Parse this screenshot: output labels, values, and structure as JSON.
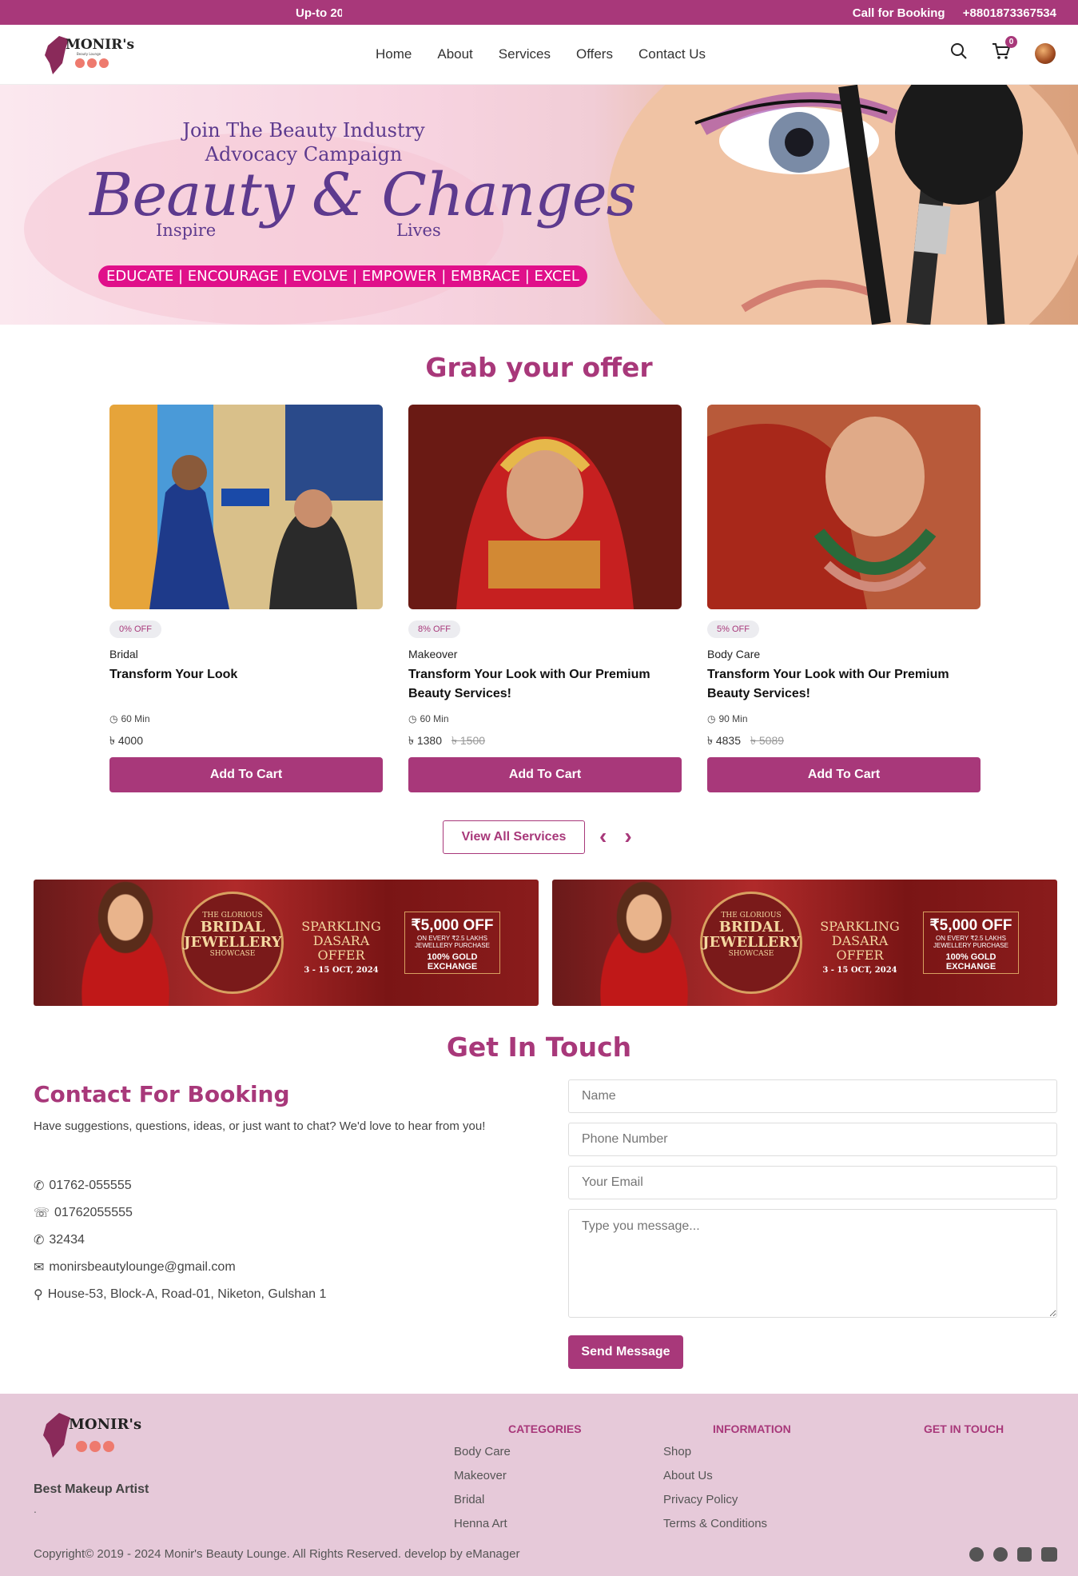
{
  "topbar": {
    "promo": "Up-to 20",
    "call_label": "Call for Booking",
    "phone": "+8801873367534"
  },
  "nav": {
    "items": [
      "Home",
      "About",
      "Services",
      "Offers",
      "Contact Us"
    ],
    "cart_count": "0"
  },
  "logo": {
    "name": "MONIR's"
  },
  "hero": {
    "line1": "Join The Beauty Industry",
    "line2": "Advocacy Campaign",
    "script": "Beauty & Changes",
    "inspire": "Inspire",
    "lives": "Lives",
    "tagline": "EDUCATE | ENCOURAGE | EVOLVE | EMPOWER | EMBRACE | EXCEL"
  },
  "offers": {
    "title": "Grab your offer",
    "cards": [
      {
        "discount": "0% OFF",
        "category": "Bridal",
        "title": "Transform Your Look",
        "duration": "60 Min",
        "price": "৳ 4000",
        "old_price": "",
        "button": "Add To Cart"
      },
      {
        "discount": "8% OFF",
        "category": "Makeover",
        "title": "Transform Your Look with Our Premium Beauty Services!",
        "duration": "60 Min",
        "price": "৳ 1380",
        "old_price": "৳ 1500",
        "button": "Add To Cart"
      },
      {
        "discount": "5% OFF",
        "category": "Body Care",
        "title": "Transform Your Look with Our Premium Beauty Services!",
        "duration": "90 Min",
        "price": "৳ 4835",
        "old_price": "৳ 5089",
        "button": "Add To Cart"
      }
    ],
    "view_all": "View All Services"
  },
  "banners": [
    {
      "medal_top": "THE GLORIOUS",
      "medal_main": "BRIDAL JEWELLERY",
      "medal_sub": "SHOWCASE",
      "dasara": "SPARKLING DASARA OFFER",
      "dates": "3 - 15 OCT, 2024",
      "off": "₹5,000 OFF",
      "off_sub": "ON EVERY ₹2.5 LAKHS JEWELLERY PURCHASE",
      "gold": "100% GOLD EXCHANGE"
    },
    {
      "medal_top": "THE GLORIOUS",
      "medal_main": "BRIDAL JEWELLERY",
      "medal_sub": "SHOWCASE",
      "dasara": "SPARKLING DASARA OFFER",
      "dates": "3 - 15 OCT, 2024",
      "off": "₹5,000 OFF",
      "off_sub": "ON EVERY ₹2.5 LAKHS JEWELLERY PURCHASE",
      "gold": "100% GOLD EXCHANGE"
    }
  ],
  "contact": {
    "section_title": "Get In Touch",
    "title": "Contact For Booking",
    "desc": "Have suggestions, questions, ideas, or just want to chat? We'd love to hear from you!",
    "phone": "01762-055555",
    "whatsapp": "01762055555",
    "extra": "32434",
    "email": "monirsbeautylounge@gmail.com",
    "address": "House-53, Block-A, Road-01, Niketon, Gulshan 1",
    "name_ph": "Name",
    "phone_ph": "Phone Number",
    "email_ph": "Your Email",
    "message_ph": "Type you message...",
    "send": "Send Message"
  },
  "footer": {
    "tagline": "Best Makeup Artist",
    "dot": ".",
    "categories_title": "CATEGORIES",
    "categories": [
      "Body Care",
      "Makeover",
      "Bridal",
      "Henna Art"
    ],
    "information_title": "INFORMATION",
    "information": [
      "Shop",
      "About Us",
      "Privacy Policy",
      "Terms & Conditions"
    ],
    "touch_title": "GET IN TOUCH",
    "copyright": "Copyright© 2019 - 2024 Monir's Beauty Lounge. All Rights Reserved. develop by eManager"
  },
  "colors": {
    "brand": "#a8387a",
    "footer_bg": "#e6c9d9",
    "tagline_pink": "#e0108a",
    "hero_purple": "#5d3a8e"
  }
}
